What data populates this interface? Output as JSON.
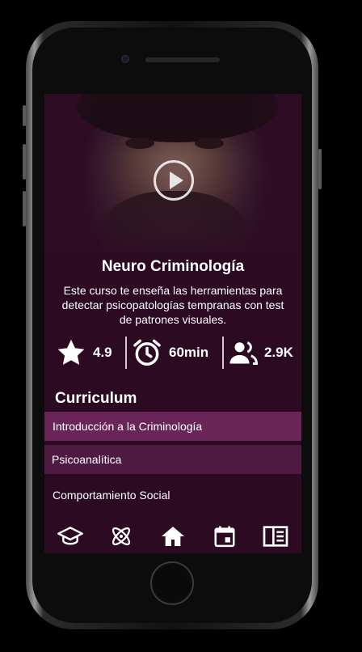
{
  "course": {
    "title": "Neuro Criminología",
    "description": "Este curso te enseña las herramientas para detectar psicopatologías tempranas con test de patrones visuales."
  },
  "stats": {
    "rating": "4.9",
    "duration": "60min",
    "students": "2.9K"
  },
  "curriculum": {
    "heading": "Curriculum",
    "items": [
      "Introducción a la Criminología",
      "Psicoanalítica",
      "Comportamiento Social"
    ]
  },
  "bottom_nav": {
    "icons": [
      "graduation-cap-icon",
      "atom-icon",
      "home-icon",
      "calendar-icon",
      "book-icon"
    ]
  },
  "colors": {
    "background": "#2b0a22",
    "row_highlight": "#6a2558",
    "row_secondary": "#4e1a41"
  }
}
